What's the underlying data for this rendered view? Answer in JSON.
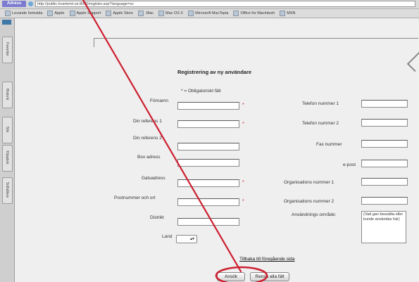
{
  "browser": {
    "address_label": "Adress",
    "url": "http://public-kvarteret.se:8080/register.asp?language=sv",
    "bookmarks": [
      "Levande hemsida",
      "Apple",
      "Apple Support",
      "Apple Store",
      ".Mac",
      "Mac OS X",
      "Microsoft MacTopia",
      "Office for Macintosh",
      "MSN"
    ]
  },
  "sidebar_tabs": [
    "Favoriter",
    "Historik",
    "Sök",
    "Klippbok",
    "Sidhållare"
  ],
  "form": {
    "title": "Registrering av ny användare",
    "required_note": "* = Obligatoriskt fält",
    "left_fields": [
      {
        "label": "Förnamn",
        "required": true
      },
      {
        "label": "Din referens 1",
        "required": true
      },
      {
        "label": "Din referens 2",
        "required": false
      },
      {
        "label": "Box adress",
        "required": false
      },
      {
        "label": "Gatuadress",
        "required": true
      },
      {
        "label": "Postnummer och ort",
        "required": true
      },
      {
        "label": "Distrikt",
        "required": false
      }
    ],
    "right_fields": [
      {
        "label": "Telefon nummer 1"
      },
      {
        "label": "Telefon nummer 2"
      },
      {
        "label": "Fax nummer"
      },
      {
        "label": "e-post"
      },
      {
        "label": "Organisations nummer 1"
      },
      {
        "label": "Organisations nummer 2"
      }
    ],
    "country_label": "Land",
    "usage_label": "Användnings område:",
    "usage_text": "(Vad gan bessätta eller kunde användas här)",
    "back_link": "Tillbaka till föregående sida",
    "submit_label": "Ansök",
    "reset_label": "Rensa alla fält"
  },
  "annotation": {
    "color": "#cc1f2f"
  }
}
